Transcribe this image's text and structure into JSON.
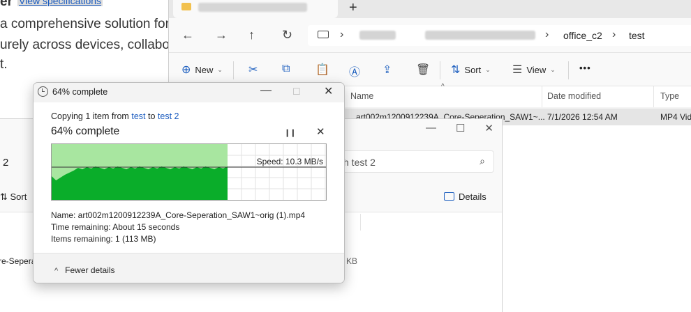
{
  "background_page": {
    "heading_fragment": "er",
    "link": "View specifications",
    "lines": [
      "a comprehensive solution for",
      "urely across devices, collabo",
      "t."
    ]
  },
  "explorer_back": {
    "new_tab_icon": "plus-icon",
    "breadcrumb": [
      "office_c2",
      "test"
    ],
    "commands": {
      "new": "New",
      "sort": "Sort",
      "view": "View",
      "more": "•••"
    },
    "columns": [
      "Name",
      "Date modified",
      "Type"
    ],
    "row": {
      "name": "art002m1200912239A_Core-Seperation_SAW1~...",
      "date": "7/1/2026 12:54 AM",
      "type": "MP4 Vid"
    }
  },
  "explorer_front": {
    "nav_fragment": "2",
    "search_placeholder": "ch test 2",
    "sort": "Sort",
    "details": "Details",
    "file_fragment": "re-Sepera",
    "size_fragment": "KB"
  },
  "dialog": {
    "title": "64% complete",
    "copying_prefix": "Copying 1 item from",
    "source": "test",
    "to_word": "to",
    "destination": "test 2",
    "status": "64% complete",
    "progress_fraction": 0.64,
    "speed": "Speed: 10.3 MB/s",
    "name_line": "Name: art002m1200912239A_Core-Seperation_SAW1~orig (1).mp4",
    "time_line": "Time remaining: About 15 seconds",
    "items_line": "Items remaining: 1 (113 MB)",
    "fewer_details": "Fewer details",
    "colors": {
      "fill_done": "#a8e6a0",
      "graph_area": "#0aad2a",
      "link": "#1a5bbf"
    }
  }
}
